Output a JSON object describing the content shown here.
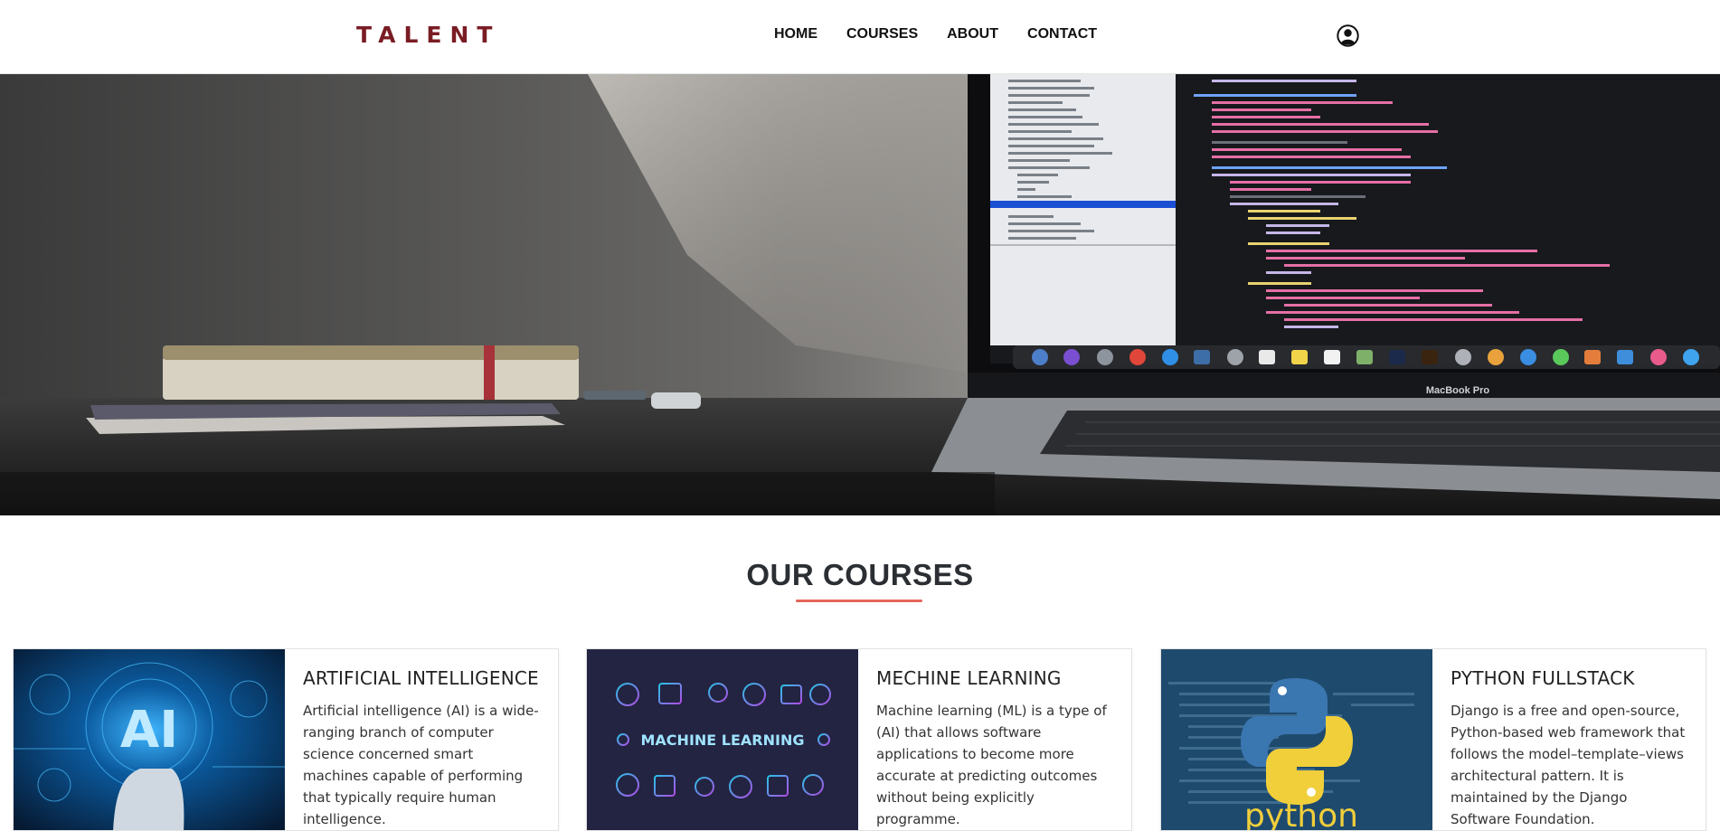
{
  "header": {
    "logo": "TALENT",
    "nav": [
      "HOME",
      "COURSES",
      "ABOUT",
      "CONTACT"
    ],
    "user_icon": "user-circle-icon"
  },
  "hero": {
    "image": "desk-laptop-photo",
    "laptop_label": "MacBook Pro"
  },
  "courses": {
    "title": "OUR COURSES",
    "accent_color": "#e5675a",
    "items": [
      {
        "title": "ARTIFICIAL INTELLIGENCE",
        "text": "Artificial intelligence (AI) is a wide-ranging branch of computer science concerned smart machines capable of performing that typically require human intelligence.",
        "image_label": "AI"
      },
      {
        "title": "MECHINE LEARNING",
        "text": "Machine learning (ML) is a type of (AI) that allows software applications to become more accurate at predicting outcomes without being explicitly programme.",
        "image_label": "MACHINE LEARNING"
      },
      {
        "title": "PYTHON FULLSTACK",
        "text": "Django is a free and open-source, Python-based web framework that follows the model–template–views architectural pattern. It is maintained by the Django Software Foundation.",
        "image_label": "python"
      }
    ]
  },
  "colors": {
    "logo": "#7a1c24",
    "ai_bg": "#0a2a4a",
    "ml_bg": "#232442",
    "python_bg": "#1e4a6e"
  }
}
